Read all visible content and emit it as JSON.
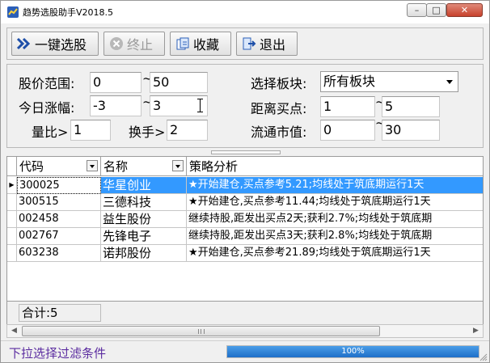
{
  "window": {
    "title": "趋势选股助手V2018.5",
    "min_label": "–",
    "max_label": "□",
    "close_label": "✕"
  },
  "toolbar": {
    "select_label": "一键选股",
    "stop_label": "终止",
    "favorite_label": "收藏",
    "exit_label": "退出"
  },
  "filters": {
    "price_range_label": "股价范围:",
    "price_min": "0",
    "price_max": "50",
    "change_label": "今日涨幅:",
    "change_min": "-3",
    "change_max": "3",
    "volume_ratio_label": "量比>",
    "volume_ratio_value": "1",
    "turnover_label": "换手>",
    "turnover_value": "2",
    "sector_label": "选择板块:",
    "sector_value": "所有板块",
    "buy_distance_label": "距离买点:",
    "buy_distance_min": "1",
    "buy_distance_max": "5",
    "float_cap_label": "流通市值:",
    "float_cap_min": "0",
    "float_cap_max": "30",
    "tilde": "~"
  },
  "grid": {
    "headers": [
      "代码",
      "名称",
      "策略分析"
    ],
    "rows": [
      {
        "code": "300025",
        "name": "华星创业",
        "strategy": "★开始建仓,买点参考5.21;均线处于筑底期运行1天"
      },
      {
        "code": "300515",
        "name": "三德科技",
        "strategy": "★开始建仓,买点参考11.44;均线处于筑底期运行1天"
      },
      {
        "code": "002458",
        "name": "益生股份",
        "strategy": "继续持股,距发出买点2天;获利2.7%;均线处于筑底期"
      },
      {
        "code": "002767",
        "name": "先锋电子",
        "strategy": "继续持股,距发出买点3天;获利2.8%;均线处于筑底期"
      },
      {
        "code": "603238",
        "name": "诺邦股份",
        "strategy": "★开始建仓,买点参考21.89;均线处于筑底期运行1天"
      }
    ],
    "selected_row": 0,
    "total_label": "合计:5"
  },
  "status": {
    "hint": "下拉选择过滤条件",
    "progress": 1.0,
    "progress_text": "100%"
  },
  "colors": {
    "selection": "#3399ff",
    "status_text": "#5b2ca0",
    "progress": "#1e6fc8"
  }
}
